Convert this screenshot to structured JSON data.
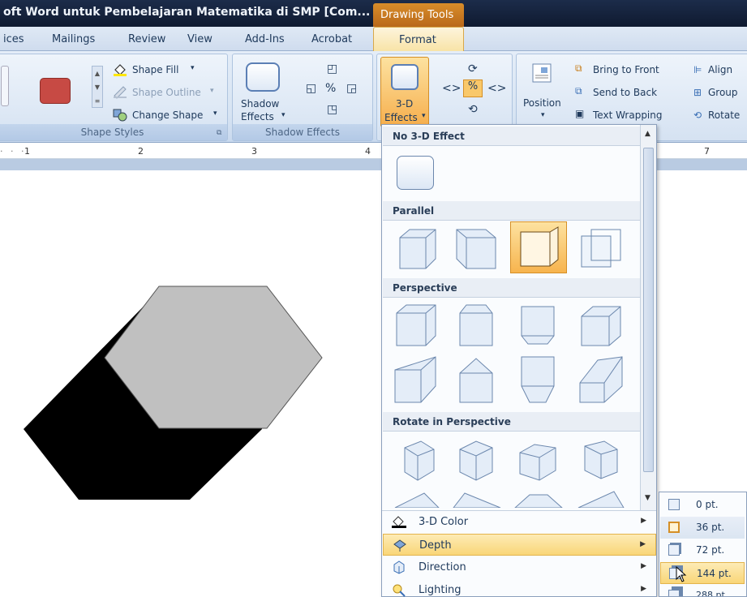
{
  "window": {
    "title": "oft Word untuk Pembelajaran Matematika di SMP [Com...",
    "contextual_tab": "Drawing Tools"
  },
  "tabs": [
    {
      "label": "ices"
    },
    {
      "label": "Mailings"
    },
    {
      "label": "Review"
    },
    {
      "label": "View"
    },
    {
      "label": "Add-Ins"
    },
    {
      "label": "Acrobat"
    },
    {
      "label": "Format"
    }
  ],
  "ribbon": {
    "shape_styles": {
      "shape_fill": "Shape Fill",
      "shape_outline": "Shape Outline",
      "change_shape": "Change Shape",
      "group_label": "Shape Styles",
      "swatch_color": "#c74a44"
    },
    "shadow": {
      "button_label_1": "Shadow",
      "button_label_2": "Effects",
      "group_label": "Shadow Effects"
    },
    "three_d": {
      "button_label_1": "3-D",
      "button_label_2": "Effects"
    },
    "arrange": {
      "position": "Position",
      "bring_to_front": "Bring to Front",
      "send_to_back": "Send to Back",
      "text_wrapping": "Text Wrapping",
      "align": "Align",
      "group": "Group",
      "rotate": "Rotate"
    }
  },
  "ruler": {
    "marks": [
      "1",
      "2",
      "3",
      "4",
      "7"
    ]
  },
  "dropdown": {
    "sections": {
      "no_effect": "No 3-D Effect",
      "parallel": "Parallel",
      "perspective": "Perspective",
      "rotate_perspective": "Rotate in Perspective"
    },
    "menu_items": [
      {
        "label": "3-D Color",
        "icon": "paint-bucket-icon"
      },
      {
        "label": "Depth",
        "icon": "depth-icon"
      },
      {
        "label": "Direction",
        "icon": "direction-icon"
      },
      {
        "label": "Lighting",
        "icon": "lighting-icon"
      }
    ],
    "highlighted_item": "Depth"
  },
  "depth_submenu": {
    "options": [
      "0 pt.",
      "36 pt.",
      "72 pt.",
      "144 pt.",
      "288 pt."
    ],
    "selected": "36 pt.",
    "hovered": "144 pt."
  },
  "colors": {
    "hexagon_face": "#c0c0c0",
    "hexagon_side": "#000000",
    "accent_orange": "#f7b44e"
  }
}
